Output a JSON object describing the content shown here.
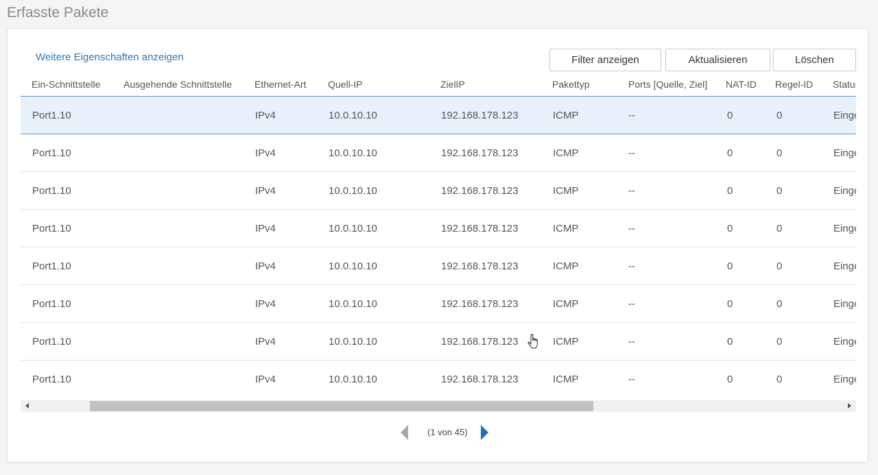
{
  "page_title": "Erfasste Pakete",
  "more_link": "Weitere Eigenschaften anzeigen",
  "buttons": {
    "filter": "Filter anzeigen",
    "refresh": "Aktualisieren",
    "delete": "Löschen"
  },
  "columns": [
    "Ein-Schnittstelle",
    "Ausgehende Schnittstelle",
    "Ethernet-Art",
    "Quell-IP",
    "ZielIP",
    "Pakettyp",
    "Ports [Quelle, Ziel]",
    "NAT-ID",
    "Regel-ID",
    "Status"
  ],
  "rows": [
    {
      "in": "Port1.10",
      "out": "",
      "eth": "IPv4",
      "src": "10.0.10.10",
      "dst": "192.168.178.123",
      "type": "ICMP",
      "ports": "--",
      "nat": "0",
      "rule": "0",
      "status": "Eingehend",
      "selected": true
    },
    {
      "in": "Port1.10",
      "out": "",
      "eth": "IPv4",
      "src": "10.0.10.10",
      "dst": "192.168.178.123",
      "type": "ICMP",
      "ports": "--",
      "nat": "0",
      "rule": "0",
      "status": "Eingehend"
    },
    {
      "in": "Port1.10",
      "out": "",
      "eth": "IPv4",
      "src": "10.0.10.10",
      "dst": "192.168.178.123",
      "type": "ICMP",
      "ports": "--",
      "nat": "0",
      "rule": "0",
      "status": "Eingehend"
    },
    {
      "in": "Port1.10",
      "out": "",
      "eth": "IPv4",
      "src": "10.0.10.10",
      "dst": "192.168.178.123",
      "type": "ICMP",
      "ports": "--",
      "nat": "0",
      "rule": "0",
      "status": "Eingehend"
    },
    {
      "in": "Port1.10",
      "out": "",
      "eth": "IPv4",
      "src": "10.0.10.10",
      "dst": "192.168.178.123",
      "type": "ICMP",
      "ports": "--",
      "nat": "0",
      "rule": "0",
      "status": "Eingehend"
    },
    {
      "in": "Port1.10",
      "out": "",
      "eth": "IPv4",
      "src": "10.0.10.10",
      "dst": "192.168.178.123",
      "type": "ICMP",
      "ports": "--",
      "nat": "0",
      "rule": "0",
      "status": "Eingehend"
    },
    {
      "in": "Port1.10",
      "out": "",
      "eth": "IPv4",
      "src": "10.0.10.10",
      "dst": "192.168.178.123",
      "type": "ICMP",
      "ports": "--",
      "nat": "0",
      "rule": "0",
      "status": "Eingehend"
    },
    {
      "in": "Port1.10",
      "out": "",
      "eth": "IPv4",
      "src": "10.0.10.10",
      "dst": "192.168.178.123",
      "type": "ICMP",
      "ports": "--",
      "nat": "0",
      "rule": "0",
      "status": "Eingehend"
    }
  ],
  "pager": {
    "label": "(1 von 45)",
    "prev_icon": "chevron-left-icon",
    "next_icon": "chevron-right-icon"
  },
  "colors": {
    "link": "#2a7ab8",
    "selected_row": "#e8f1f9",
    "accent": "#1f6fc1"
  }
}
